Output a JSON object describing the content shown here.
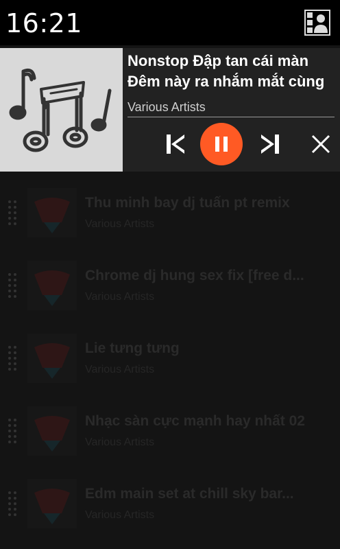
{
  "status_bar": {
    "time": "16:21",
    "icon": "person-card-icon"
  },
  "now_playing": {
    "title_line1": "Nonstop Đập tan cái màn",
    "title_line2": "Đêm này ra nhắm mắt cùng",
    "artist": "Various Artists",
    "album_art_icon": "music-notes-icon",
    "controls": {
      "prev_icon": "skip-previous-icon",
      "play_state_icon": "pause-icon",
      "next_icon": "skip-next-icon",
      "close_icon": "close-icon"
    },
    "accent_color": "#ff5a24"
  },
  "playlist": [
    {
      "title": "Thu minh bay dj tuấn pt remix",
      "artist": "Various Artists"
    },
    {
      "title": "Chrome dj hung sex fix [free d...",
      "artist": "Various Artists"
    },
    {
      "title": "Lie tưng tưng",
      "artist": "Various Artists"
    },
    {
      "title": "Nhạc sàn cực mạnh hay nhất 02",
      "artist": "Various Artists"
    },
    {
      "title": "Edm main set at chill sky bar...",
      "artist": "Various Artists"
    }
  ]
}
